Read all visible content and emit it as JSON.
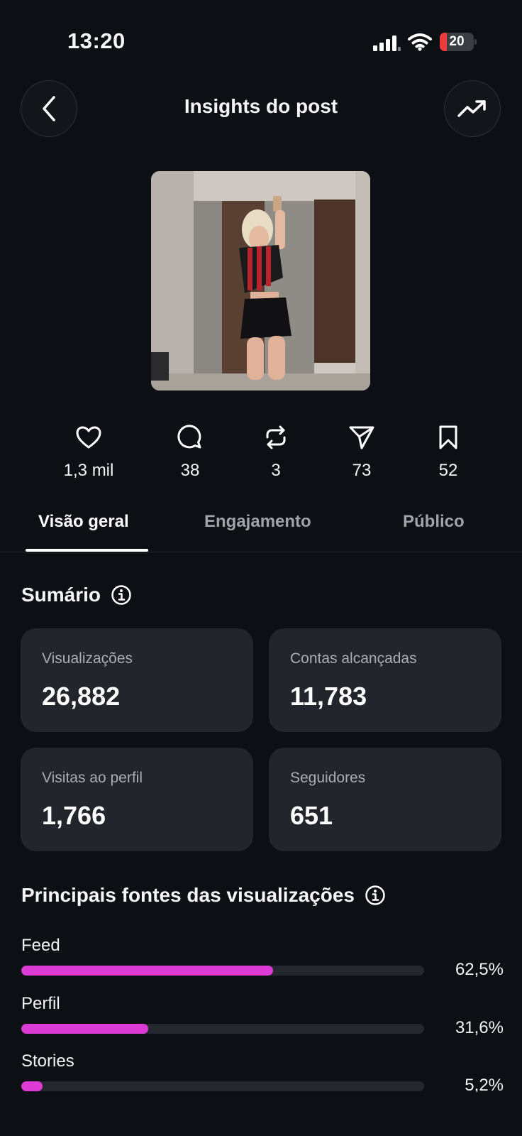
{
  "status_bar": {
    "time": "13:20",
    "battery": "20",
    "battery_level": 0.2,
    "battery_color": "#eb3b3b"
  },
  "header": {
    "title": "Insights do post",
    "back_icon": "chevron-left-icon",
    "trend_icon": "trending-up-icon"
  },
  "post_stats": [
    {
      "icon": "heart-icon",
      "value": "1,3 mil"
    },
    {
      "icon": "comment-icon",
      "value": "38"
    },
    {
      "icon": "repost-icon",
      "value": "3"
    },
    {
      "icon": "send-icon",
      "value": "73"
    },
    {
      "icon": "bookmark-icon",
      "value": "52"
    }
  ],
  "tabs": [
    {
      "label": "Visão geral",
      "active": true
    },
    {
      "label": "Engajamento",
      "active": false
    },
    {
      "label": "Público",
      "active": false
    }
  ],
  "summary": {
    "title": "Sumário",
    "cards": [
      {
        "label": "Visualizações",
        "value": "26,882"
      },
      {
        "label": "Contas alcançadas",
        "value": "11,783"
      },
      {
        "label": "Visitas ao perfil",
        "value": "1,766"
      },
      {
        "label": "Seguidores",
        "value": "651"
      }
    ]
  },
  "sources": {
    "title": "Principais fontes das visualizações",
    "bar_color": "#dd3bd6",
    "items": [
      {
        "name": "Feed",
        "percent_label": "62,5%",
        "percent": 62.5
      },
      {
        "name": "Perfil",
        "percent_label": "31,6%",
        "percent": 31.6
      },
      {
        "name": "Stories",
        "percent_label": "5,2%",
        "percent": 5.2
      }
    ]
  }
}
